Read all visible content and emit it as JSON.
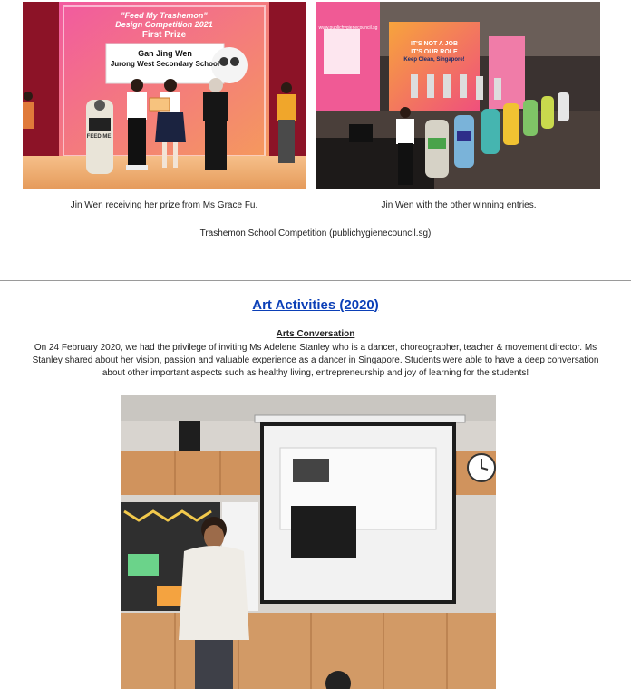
{
  "photos": {
    "photo1": {
      "banner_line1": "\"Feed My Trashemon\"",
      "banner_line2": "Design Competition 2021",
      "banner_line3": "First Prize",
      "board_name": "Gan Jing Wen",
      "board_school": "Jurong West Secondary School",
      "bin_text": "FEED ME!"
    },
    "photo2": {
      "screen_line1": "IT'S NOT A JOB",
      "screen_line2": "IT'S OUR ROLE",
      "screen_line3": "Keep Clean, Singapore!",
      "screen_url": "www.publichygienecouncil.sg"
    }
  },
  "captions": {
    "left": "Jin Wen receiving her prize from Ms Grace Fu.",
    "right": "Jin Wen with the other winning entries.",
    "source": "Trashemon School Competition (publichygienecouncil.sg)"
  },
  "section": {
    "title": "Art Activities (2020)",
    "subtitle": "Arts Conversation",
    "paragraph": "On 24 February 2020, we had the privilege of inviting Ms Adelene Stanley who is a dancer, choreographer, teacher & movement director. Ms Stanley shared about her vision, passion and valuable experience as a dancer in Singapore. Students were able to have a deep conversation about other important aspects such as healthy living, entrepreneurship and joy of learning for the students!"
  },
  "colors": {
    "link": "#0b3fb7",
    "stage_pink": "#f04e8e",
    "stage_orange": "#f7a24b"
  }
}
